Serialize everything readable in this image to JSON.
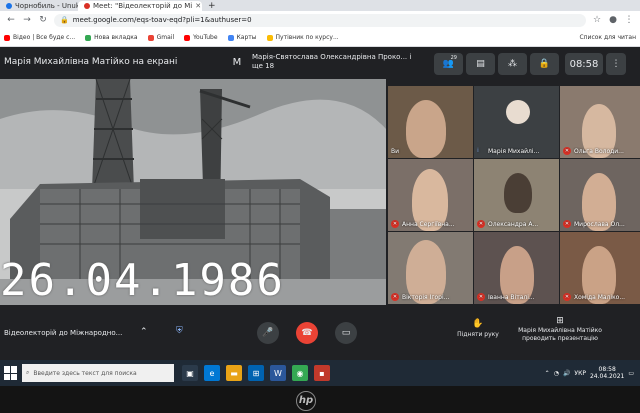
{
  "browser": {
    "tabs": [
      {
        "title": "Чорнобиль - Unukhe",
        "active": false
      },
      {
        "title": "Meet: \"Відеолекторій до Мі",
        "active": true
      }
    ],
    "new_tab": "+",
    "url": "meet.google.com/eqs-toav-eqd?pli=1&authuser=0",
    "bookmarks": [
      "Відео | Все буде с...",
      "Нова вкладка",
      "Gmail",
      "YouTube",
      "Карты",
      "Путівник по курсу..."
    ],
    "bookmarks_right": "Список для читан"
  },
  "meet": {
    "presenter_title": "Марія Михайлівна Матійко на екрані",
    "second_participant_initial": "М",
    "second_participant": "Марія-Святослава Олександрівна Проко... і ще 18",
    "participant_count": "29",
    "clock": "08:58",
    "presentation_date": "26.04.1986",
    "participants": [
      {
        "name": "Ви",
        "muted": false
      },
      {
        "name": "Марія Михайлі...",
        "muted": false
      },
      {
        "name": "Ольга Володи...",
        "muted": true
      },
      {
        "name": "Анна Сергіївна...",
        "muted": true
      },
      {
        "name": "Олександра А...",
        "muted": true
      },
      {
        "name": "Мирослава Ол...",
        "muted": true
      },
      {
        "name": "Вікторія Ігорі...",
        "muted": true
      },
      {
        "name": "Іванна Віталі...",
        "muted": true
      },
      {
        "name": "Хоміда Маліко...",
        "muted": true
      }
    ],
    "meeting_title": "Відеолекторій до Міжнародно...",
    "raise_hand": "Підняти руку",
    "presenting": "Марія Михайлівна Матійко проводить презентацію"
  },
  "taskbar": {
    "search_placeholder": "Введите здесь текст для поиска",
    "language": "УКР",
    "time": "08:58",
    "date": "24.04.2021"
  },
  "brand": "hp",
  "colors": {
    "meet_bg": "#202124",
    "mic_off": "#d93025",
    "accent": "#8ab4f8"
  }
}
